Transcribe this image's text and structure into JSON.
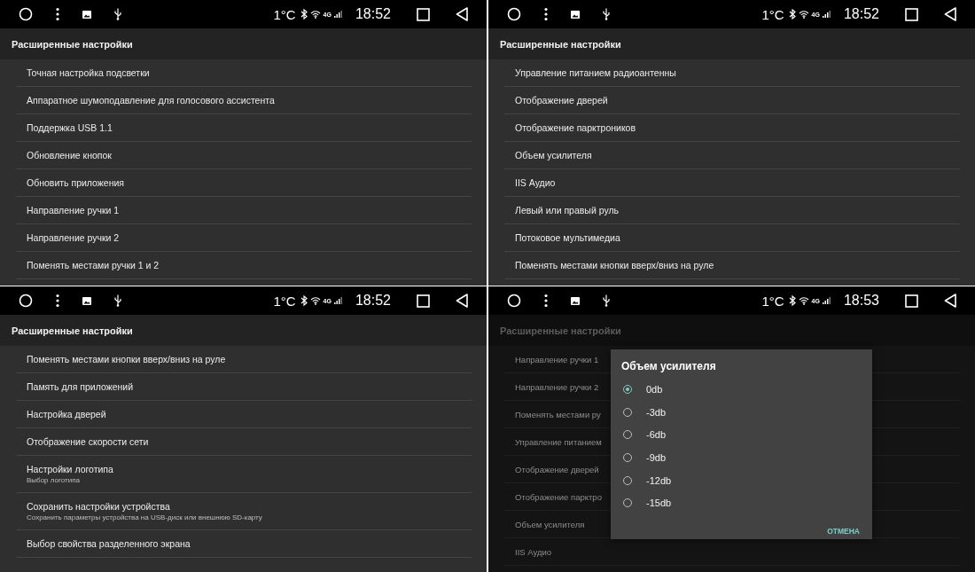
{
  "panels": [
    {
      "dimmed": false,
      "status": {
        "temperature": "1°C",
        "network": "4G",
        "time": "18:52"
      },
      "header": "Расширенные настройки",
      "items": [
        {
          "title": "Точная настройка подсветки"
        },
        {
          "title": "Аппаратное шумоподавление для голосового ассистента"
        },
        {
          "title": "Поддержка USB 1.1"
        },
        {
          "title": "Обновление кнопок"
        },
        {
          "title": "Обновить приложения"
        },
        {
          "title": "Направление ручки 1"
        },
        {
          "title": "Направление ручки 2"
        },
        {
          "title": "Поменять местами ручки 1 и 2"
        }
      ]
    },
    {
      "dimmed": false,
      "status": {
        "temperature": "1°C",
        "network": "4G",
        "time": "18:52"
      },
      "header": "Расширенные настройки",
      "items": [
        {
          "title": "Управление питанием радиоантенны"
        },
        {
          "title": "Отображение дверей"
        },
        {
          "title": "Отображение парктроников"
        },
        {
          "title": "Объем усилителя"
        },
        {
          "title": "IIS Аудио"
        },
        {
          "title": "Левый или правый руль"
        },
        {
          "title": "Потоковое мультимедиа"
        },
        {
          "title": "Поменять местами кнопки вверх/вниз на руле"
        }
      ]
    },
    {
      "dimmed": false,
      "status": {
        "temperature": "1°C",
        "network": "4G",
        "time": "18:52"
      },
      "header": "Расширенные настройки",
      "items": [
        {
          "title": "Поменять местами кнопки вверх/вниз на руле"
        },
        {
          "title": "Память для приложений"
        },
        {
          "title": "Настройка дверей"
        },
        {
          "title": "Отображение скорости сети"
        },
        {
          "title": "Настройки логотипа",
          "subtitle": "Выбор логотипа"
        },
        {
          "title": "Сохранить настройки устройства",
          "subtitle": "Сохранить параметры устройства на USB-диск или внешнюю SD-карту"
        },
        {
          "title": "Выбор свойства разделенного экрана"
        }
      ]
    },
    {
      "dimmed": true,
      "status": {
        "temperature": "1°C",
        "network": "4G",
        "time": "18:53"
      },
      "header": "Расширенные настройки",
      "items": [
        {
          "title": "Направление ручки 1"
        },
        {
          "title": "Направление ручки 2"
        },
        {
          "title": "Поменять местами ру"
        },
        {
          "title": "Управление питанием"
        },
        {
          "title": "Отображение дверей"
        },
        {
          "title": "Отображение парктро"
        },
        {
          "title": "Объем усилителя"
        },
        {
          "title": "IIS Аудио"
        }
      ],
      "dialog": {
        "title": "Объем усилителя",
        "options": [
          {
            "label": "0db",
            "selected": true
          },
          {
            "label": "-3db",
            "selected": false
          },
          {
            "label": "-6db",
            "selected": false
          },
          {
            "label": "-9db",
            "selected": false
          },
          {
            "label": "-12db",
            "selected": false
          },
          {
            "label": "-15db",
            "selected": false
          }
        ],
        "button": "ОТМЕНА"
      }
    }
  ]
}
